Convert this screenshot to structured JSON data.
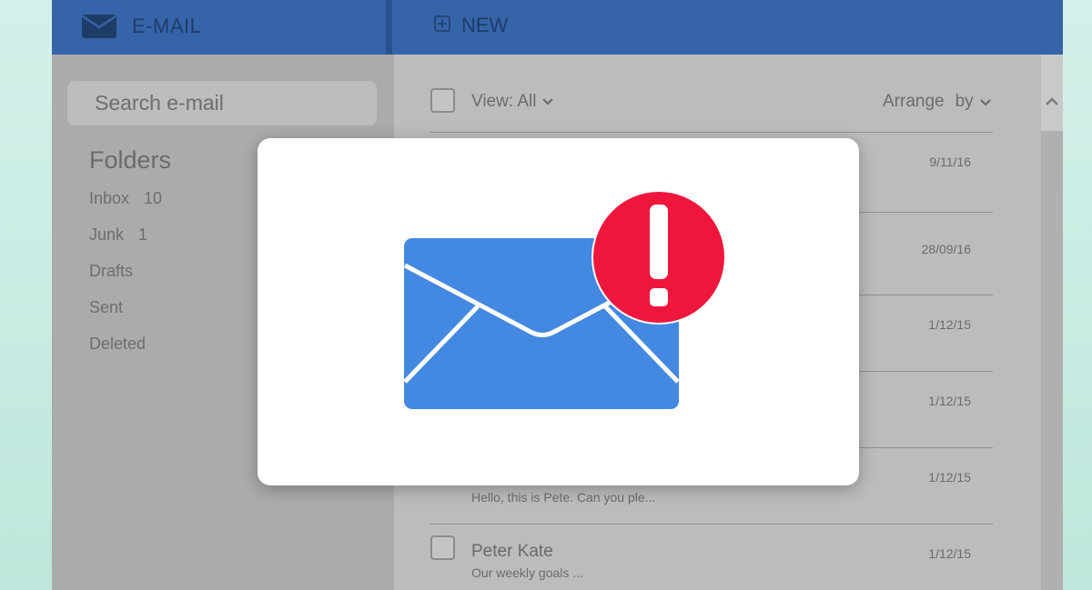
{
  "header": {
    "brand_label": "E-MAIL",
    "new_label": "NEW"
  },
  "search": {
    "placeholder": "Search e-mail"
  },
  "sidebar": {
    "folders_title": "Folders",
    "folders": [
      {
        "label": "Inbox",
        "count": "10"
      },
      {
        "label": "Junk",
        "count": "1"
      },
      {
        "label": "Drafts",
        "count": ""
      },
      {
        "label": "Sent",
        "count": ""
      },
      {
        "label": "Deleted",
        "count": ""
      }
    ]
  },
  "toolbar": {
    "view_label": "View: All",
    "arrange_word1": "Arrange",
    "arrange_word2": "by"
  },
  "messages": [
    {
      "date": "9/11/16",
      "sender": "",
      "preview": ""
    },
    {
      "date": "28/09/16",
      "sender": "",
      "preview": ""
    },
    {
      "date": "1/12/15",
      "sender": "",
      "preview": ""
    },
    {
      "date": "1/12/15",
      "sender": "",
      "preview": ""
    },
    {
      "date": "1/12/15",
      "sender": "",
      "preview": "Hello, this is Pete. Can you ple..."
    },
    {
      "date": "1/12/15",
      "sender": "Peter Kate",
      "preview": "Our weekly goals ..."
    }
  ],
  "modal": {
    "icon": "envelope-alert-icon",
    "envelope_color": "#4388e1",
    "alert_color": "#ef163e"
  },
  "colors": {
    "header": "#3564a8",
    "sidebar": "#ababab",
    "content": "#bcbcbc"
  }
}
